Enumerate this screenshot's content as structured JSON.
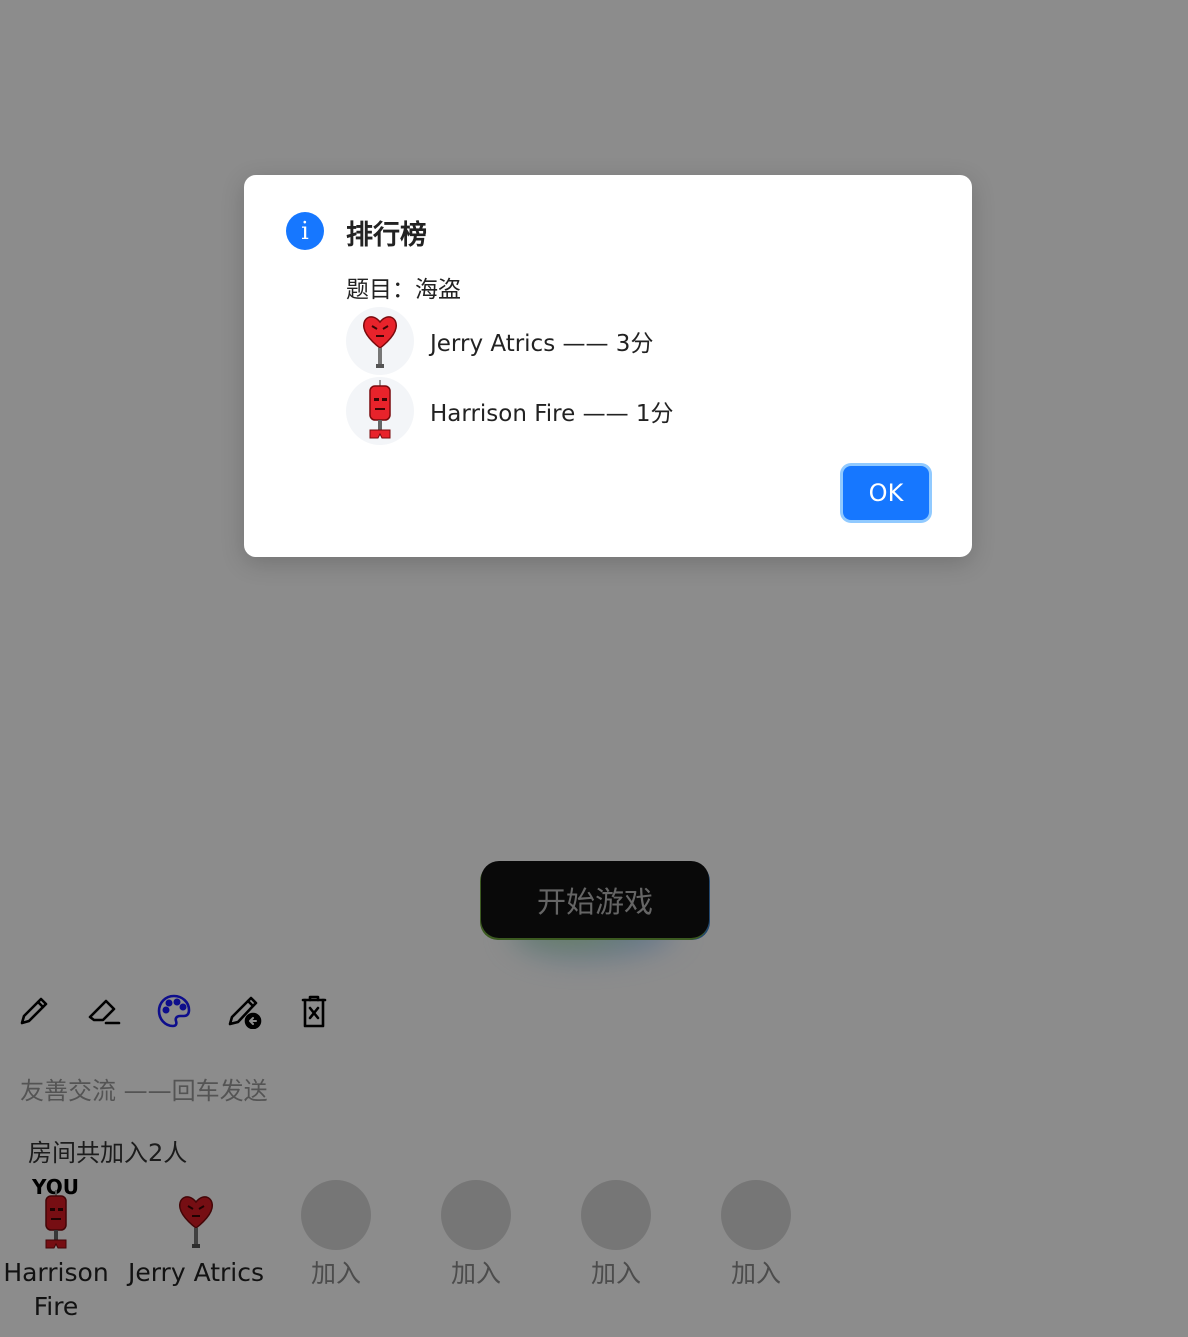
{
  "start_button": {
    "label": "开始游戏"
  },
  "toolbar": {
    "items": [
      {
        "icon": "pencil-icon"
      },
      {
        "icon": "eraser-icon"
      },
      {
        "icon": "palette-icon",
        "color": "#1a1aff"
      },
      {
        "icon": "pen-undo-icon"
      },
      {
        "icon": "trash-icon"
      }
    ]
  },
  "chat": {
    "placeholder": "友善交流 ——回车发送"
  },
  "room": {
    "count_text": "房间共加入2人"
  },
  "players": [
    {
      "name": "Harrison Fire",
      "tag": "YOU",
      "avatar": "fire-extinguisher-avatar"
    },
    {
      "name": "Jerry Atrics",
      "avatar": "heart-lamp-avatar"
    }
  ],
  "join_slots": [
    "加入",
    "加入",
    "加入",
    "加入"
  ],
  "modal": {
    "icon": "info-icon",
    "icon_glyph": "i",
    "title": "排行榜",
    "topic": "题目：海盗",
    "rankings": [
      {
        "text": "Jerry Atrics —— 3分",
        "avatar": "heart-lamp-avatar"
      },
      {
        "text": "Harrison Fire —— 1分",
        "avatar": "fire-extinguisher-avatar"
      }
    ],
    "ok_label": "OK"
  },
  "colors": {
    "accent": "#1677ff",
    "palette_icon": "#1a1aff",
    "overlay": "rgba(0,0,0,0.45)"
  }
}
